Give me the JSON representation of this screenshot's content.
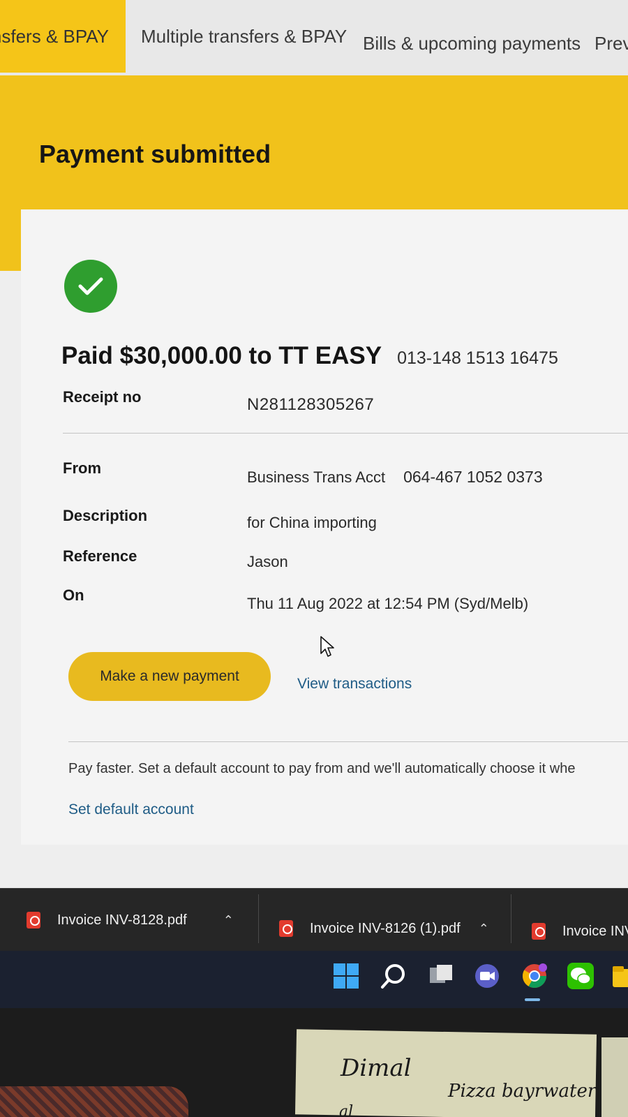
{
  "tabs": [
    {
      "label": "ansfers & BPAY",
      "active": true
    },
    {
      "label": "Multiple transfers & BPAY",
      "active": false
    },
    {
      "label": "Bills & upcoming payments",
      "active": false
    },
    {
      "label": "Prev",
      "active": false
    }
  ],
  "page_title": "Payment submitted",
  "status_icon": "check-icon",
  "summary": {
    "paid_text": "Paid $30,000.00 to TT EASY",
    "to_account": "013-148 1513 16475"
  },
  "details": {
    "receipt": {
      "label": "Receipt no",
      "value": "N281128305267"
    },
    "from": {
      "label": "From",
      "account_name": "Business Trans Acct",
      "account_number": "064-467 1052 0373"
    },
    "description": {
      "label": "Description",
      "value": "for China importing"
    },
    "reference": {
      "label": "Reference",
      "value": "Jason"
    },
    "on": {
      "label": "On",
      "value": "Thu 11 Aug 2022 at 12:54 PM (Syd/Melb)"
    }
  },
  "actions": {
    "new_payment": "Make a new payment",
    "view_transactions": "View transactions"
  },
  "promo": {
    "text": "Pay faster. Set a default account to pay from and we'll automatically choose it whe",
    "link": "Set default account"
  },
  "downloads": [
    {
      "name": "Invoice INV-8128.pdf"
    },
    {
      "name": "Invoice INV-8126 (1).pdf"
    },
    {
      "name": "Invoice INV"
    }
  ],
  "taskbar_icons": [
    "windows-start-icon",
    "search-icon",
    "task-view-icon",
    "teams-chat-icon",
    "chrome-icon",
    "wechat-icon",
    "file-explorer-icon"
  ],
  "sticky_note": {
    "line1": "Dimal",
    "line2": "Pizza bayrwater",
    "line3": "al"
  },
  "colors": {
    "brand_yellow": "#f1c21b",
    "success_green": "#2f9e2f",
    "link_blue": "#1f5c86",
    "taskbar": "#1b2130"
  }
}
